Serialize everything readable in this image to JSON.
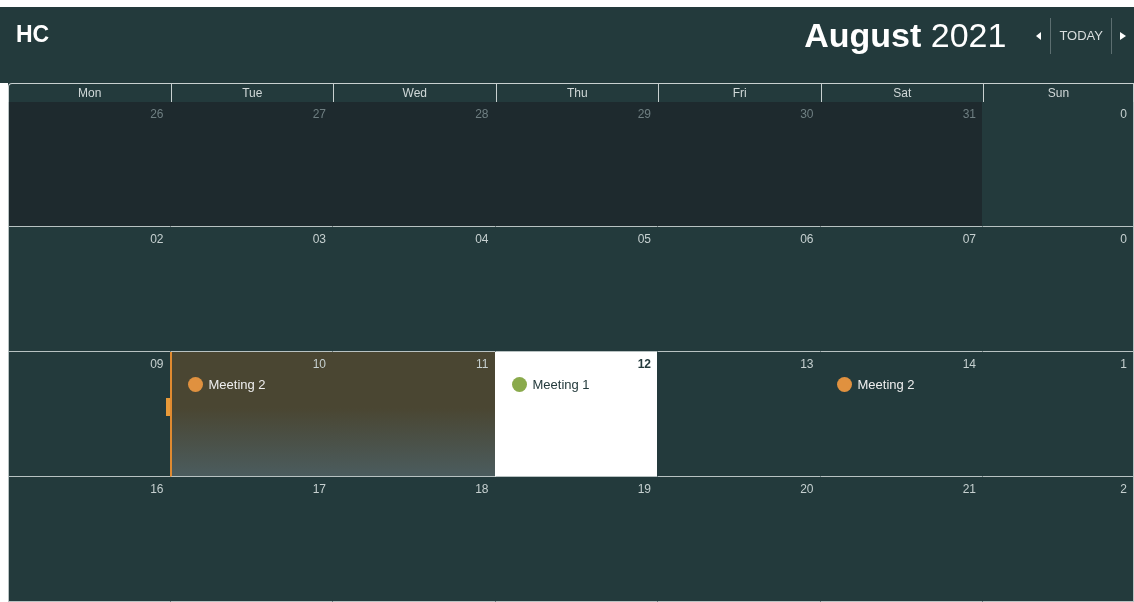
{
  "header": {
    "title": "HC",
    "month": "August",
    "year": "2021",
    "today_button": "TODAY"
  },
  "weekdays": [
    "Mon",
    "Tue",
    "Wed",
    "Thu",
    "Fri",
    "Sat",
    "Sun"
  ],
  "weeks": [
    {
      "days": [
        {
          "date": "26",
          "kind": "other",
          "selected": false
        },
        {
          "date": "27",
          "kind": "other",
          "selected": false
        },
        {
          "date": "28",
          "kind": "other",
          "selected": false
        },
        {
          "date": "29",
          "kind": "other",
          "selected": false
        },
        {
          "date": "30",
          "kind": "other",
          "selected": false
        },
        {
          "date": "31",
          "kind": "other",
          "selected": false
        },
        {
          "date": "0",
          "kind": "current",
          "selected": false
        }
      ]
    },
    {
      "days": [
        {
          "date": "02",
          "kind": "current",
          "selected": false
        },
        {
          "date": "03",
          "kind": "current",
          "selected": false
        },
        {
          "date": "04",
          "kind": "current",
          "selected": false
        },
        {
          "date": "05",
          "kind": "current",
          "selected": false
        },
        {
          "date": "06",
          "kind": "current",
          "selected": false
        },
        {
          "date": "07",
          "kind": "current",
          "selected": false
        },
        {
          "date": "0",
          "kind": "current",
          "selected": false
        }
      ]
    },
    {
      "days": [
        {
          "date": "09",
          "kind": "current",
          "selected": false
        },
        {
          "date": "10",
          "kind": "current",
          "selected": true,
          "events": [
            {
              "label": "Meeting 2",
              "color": "#e0913f"
            }
          ]
        },
        {
          "date": "11",
          "kind": "current",
          "selected": true
        },
        {
          "date": "12",
          "kind": "today",
          "selected": false,
          "events": [
            {
              "label": "Meeting 1",
              "color": "#8aaa4c"
            }
          ]
        },
        {
          "date": "13",
          "kind": "current",
          "selected": false
        },
        {
          "date": "14",
          "kind": "current",
          "selected": false,
          "events": [
            {
              "label": "Meeting 2",
              "color": "#e0913f"
            }
          ]
        },
        {
          "date": "1",
          "kind": "current",
          "selected": false
        }
      ]
    },
    {
      "days": [
        {
          "date": "16",
          "kind": "current",
          "selected": false
        },
        {
          "date": "17",
          "kind": "current",
          "selected": false
        },
        {
          "date": "18",
          "kind": "current",
          "selected": false
        },
        {
          "date": "19",
          "kind": "current",
          "selected": false
        },
        {
          "date": "20",
          "kind": "current",
          "selected": false
        },
        {
          "date": "21",
          "kind": "current",
          "selected": false
        },
        {
          "date": "2",
          "kind": "current",
          "selected": false
        }
      ]
    }
  ]
}
